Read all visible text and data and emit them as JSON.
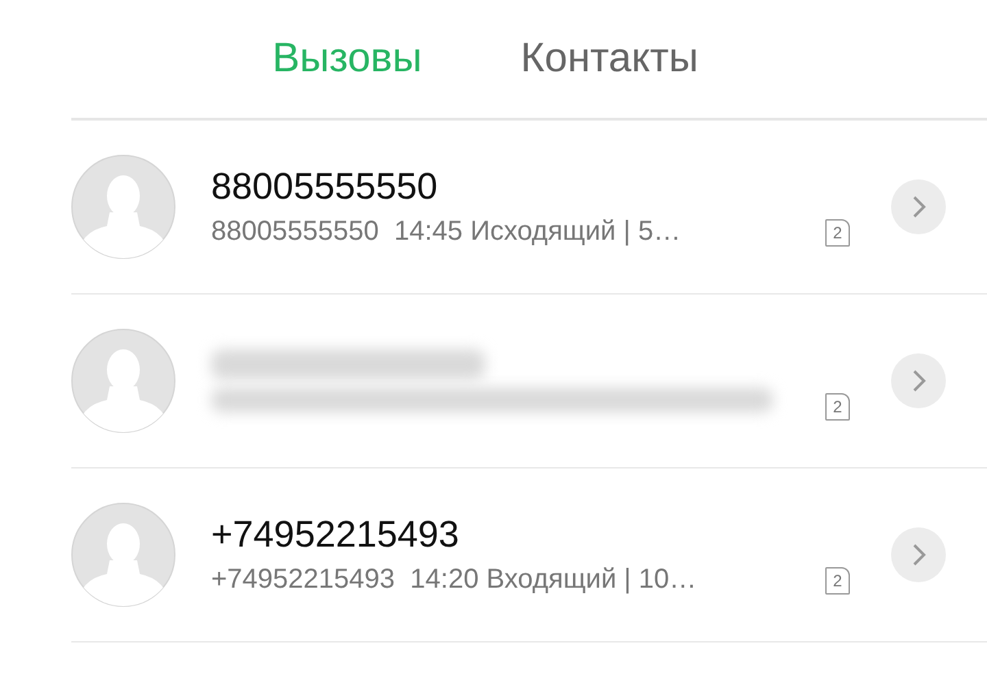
{
  "tabs": [
    {
      "label": "Вызовы",
      "selected": true
    },
    {
      "label": "Контакты",
      "selected": false
    }
  ],
  "calls": [
    {
      "blurred": false,
      "name": "88005555550",
      "detail": "88005555550  14:45 Исходящий | 5…",
      "sim": "2"
    },
    {
      "blurred": true,
      "sim": "2"
    },
    {
      "blurred": false,
      "name": "+74952215493",
      "detail": "+74952215493  14:20 Входящий | 10…",
      "sim": "2"
    }
  ]
}
